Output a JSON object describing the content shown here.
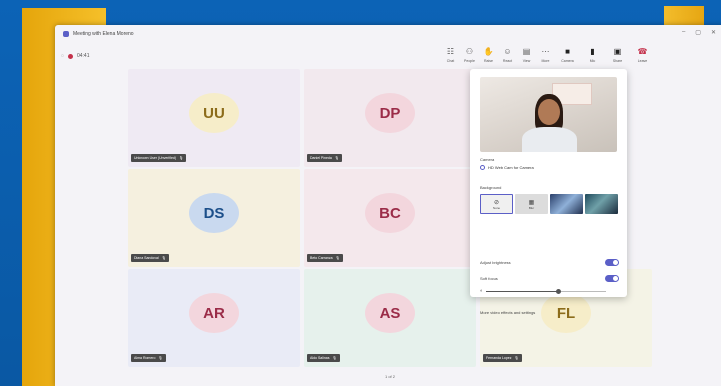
{
  "window": {
    "title": "Meeting with Elena Moreno",
    "controls": [
      "–",
      "▢",
      "✕"
    ]
  },
  "toolbar": {
    "timer": "04:41",
    "buttons": [
      {
        "label": "Chat",
        "icon": "chat-icon",
        "glyph": "☷"
      },
      {
        "label": "People",
        "icon": "people-icon",
        "glyph": "⚇"
      },
      {
        "label": "Raise",
        "icon": "raise-hand-icon",
        "glyph": "✋"
      },
      {
        "label": "React",
        "icon": "react-icon",
        "glyph": "☺"
      },
      {
        "label": "View",
        "icon": "view-icon",
        "glyph": "▤"
      },
      {
        "label": "More",
        "icon": "more-icon",
        "glyph": "⋯"
      },
      {
        "label": "Camera",
        "icon": "camera-icon",
        "glyph": "■"
      },
      {
        "label": "Mic",
        "icon": "mic-icon",
        "glyph": "▮"
      },
      {
        "label": "Share",
        "icon": "share-icon",
        "glyph": "▣"
      },
      {
        "label": "Leave",
        "icon": "leave-icon",
        "glyph": "☎"
      }
    ]
  },
  "participants": [
    {
      "initials": "UU",
      "name": "Unknown User (Unverified)",
      "bg": "#efeaf3",
      "avatar_bg": "#f6edc9",
      "avatar_fg": "#8c6c1a"
    },
    {
      "initials": "DP",
      "name": "Daniel Pineda",
      "bg": "#f2e9ee",
      "avatar_bg": "#f3d6dd",
      "avatar_fg": "#9b2c48"
    },
    {
      "initials": "DS",
      "name": "Diana Sandoval",
      "bg": "#f5f0df",
      "avatar_bg": "#c9d9ef",
      "avatar_fg": "#1c4f8a"
    },
    {
      "initials": "BC",
      "name": "Beto Carranza",
      "bg": "#f4e8ec",
      "avatar_bg": "#f3d6dd",
      "avatar_fg": "#9b2c48"
    },
    {
      "initials": "AR",
      "name": "Alma Romero",
      "bg": "#e9ebf6",
      "avatar_bg": "#f3d6dd",
      "avatar_fg": "#9b2c48"
    },
    {
      "initials": "AS",
      "name": "Aldo Salinas",
      "bg": "#e6f1ec",
      "avatar_bg": "#f3d6dd",
      "avatar_fg": "#9b2c48"
    },
    {
      "initials": "FL",
      "name": "Fernanda Lopez",
      "bg": "#f4f3e6",
      "avatar_bg": "#f6edc9",
      "avatar_fg": "#8c6c1a"
    }
  ],
  "pagination": "1 of 2",
  "camera_panel": {
    "camera_label": "Camera",
    "camera_device": "HD Web Cam for Camera",
    "background_label": "Background",
    "background_options": [
      {
        "label": "None"
      },
      {
        "label": "Blur"
      },
      {
        "label": ""
      },
      {
        "label": ""
      }
    ],
    "adjust_brightness_label": "Adjust brightness",
    "brightness_on": true,
    "soft_focus_label": "Soft focus",
    "soft_focus_on": true,
    "soft_focus_level": 0.6,
    "more_settings_link": "More video effects and settings"
  },
  "colors": {
    "accent": "#5b5fc7",
    "leave": "#c4314b"
  }
}
